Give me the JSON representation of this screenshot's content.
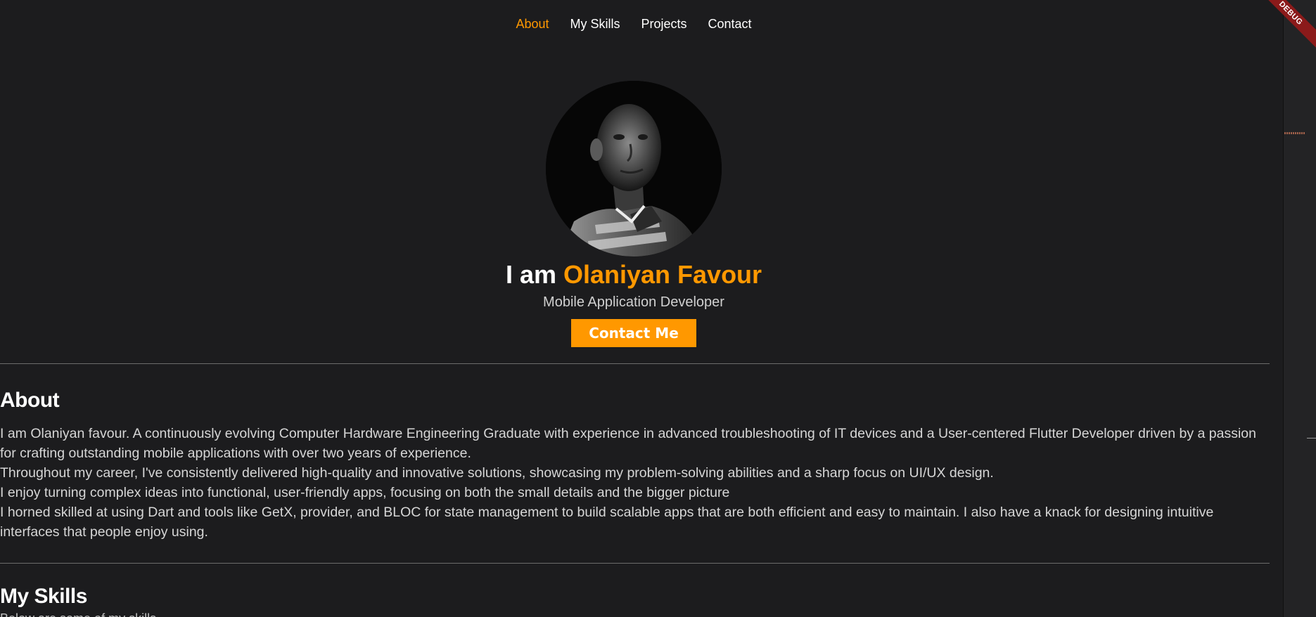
{
  "nav": {
    "items": [
      {
        "label": "About",
        "active": true
      },
      {
        "label": "My Skills",
        "active": false
      },
      {
        "label": "Projects",
        "active": false
      },
      {
        "label": "Contact",
        "active": false
      }
    ]
  },
  "hero": {
    "title_prefix": "I am ",
    "title_name": "Olaniyan Favour",
    "subtitle": "Mobile Application Developer",
    "cta_label": "Contact Me"
  },
  "about": {
    "heading": "About",
    "paragraphs": [
      "I am Olaniyan favour. A continuously evolving Computer Hardware Engineering Graduate with experience in advanced troubleshooting of IT devices and a User-centered Flutter Developer driven by a passion for crafting outstanding mobile applications with over two years of experience.",
      "Throughout my career, I've consistently delivered high-quality and innovative solutions, showcasing my problem-solving abilities and a sharp focus on UI/UX design.",
      "I enjoy turning complex ideas into functional, user-friendly apps, focusing on both the small details and the bigger picture",
      "I horned skilled at using Dart and tools like GetX, provider, and BLOC for state management to build scalable apps that are both efficient and easy to maintain. I also have a knack for designing intuitive interfaces that people enjoy using."
    ]
  },
  "skills": {
    "heading": "My Skills",
    "subtitle": "Below are some of my skills"
  },
  "debug_banner": "DEBUG",
  "colors": {
    "accent": "#ff9800",
    "background": "#1c1c1e",
    "ribbon": "#8b1a1a"
  }
}
